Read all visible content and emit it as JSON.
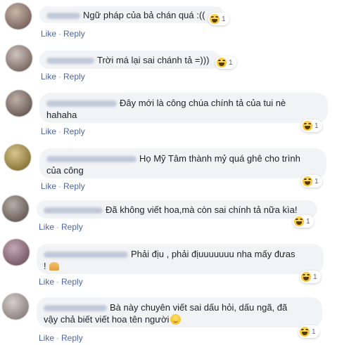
{
  "actions": {
    "like": "Like",
    "reply": "Reply",
    "separator": "·"
  },
  "comments": [
    {
      "text": "Ngữ pháp của bả chán quá :((",
      "reaction_count": "1"
    },
    {
      "text": "Trời má lại sai chánh tả =)))",
      "reaction_count": "1"
    },
    {
      "text": "Đây mới là công chúa chính tả của tui nè\nhahaha",
      "reaction_count": "1"
    },
    {
      "text": "Họ Mỹ Tâm thành mỷ quá ghê cho trình\ncủa công",
      "reaction_count": "1"
    },
    {
      "text": "Đã không viết hoa,mà còn sai chính tả nữa kìa!",
      "reaction_count": "1"
    },
    {
      "text": "Phải địu , phải địuuuuuuu nha mấy đưas\n!",
      "reaction_count": "1"
    },
    {
      "text": "Bà này chuyên viết sai dấu hỏi, dấu ngã, đã\nvậy chả biết viết hoa tên người",
      "reaction_count": "1"
    }
  ],
  "icons": {
    "reaction": "haha-reaction-icon",
    "inline_emoji": "smile-emoji-icon",
    "pray": "pray-emoji-icon"
  },
  "colors": {
    "bubble": "#f2f3f5",
    "link": "#4b67a1",
    "text": "#1d2129"
  }
}
